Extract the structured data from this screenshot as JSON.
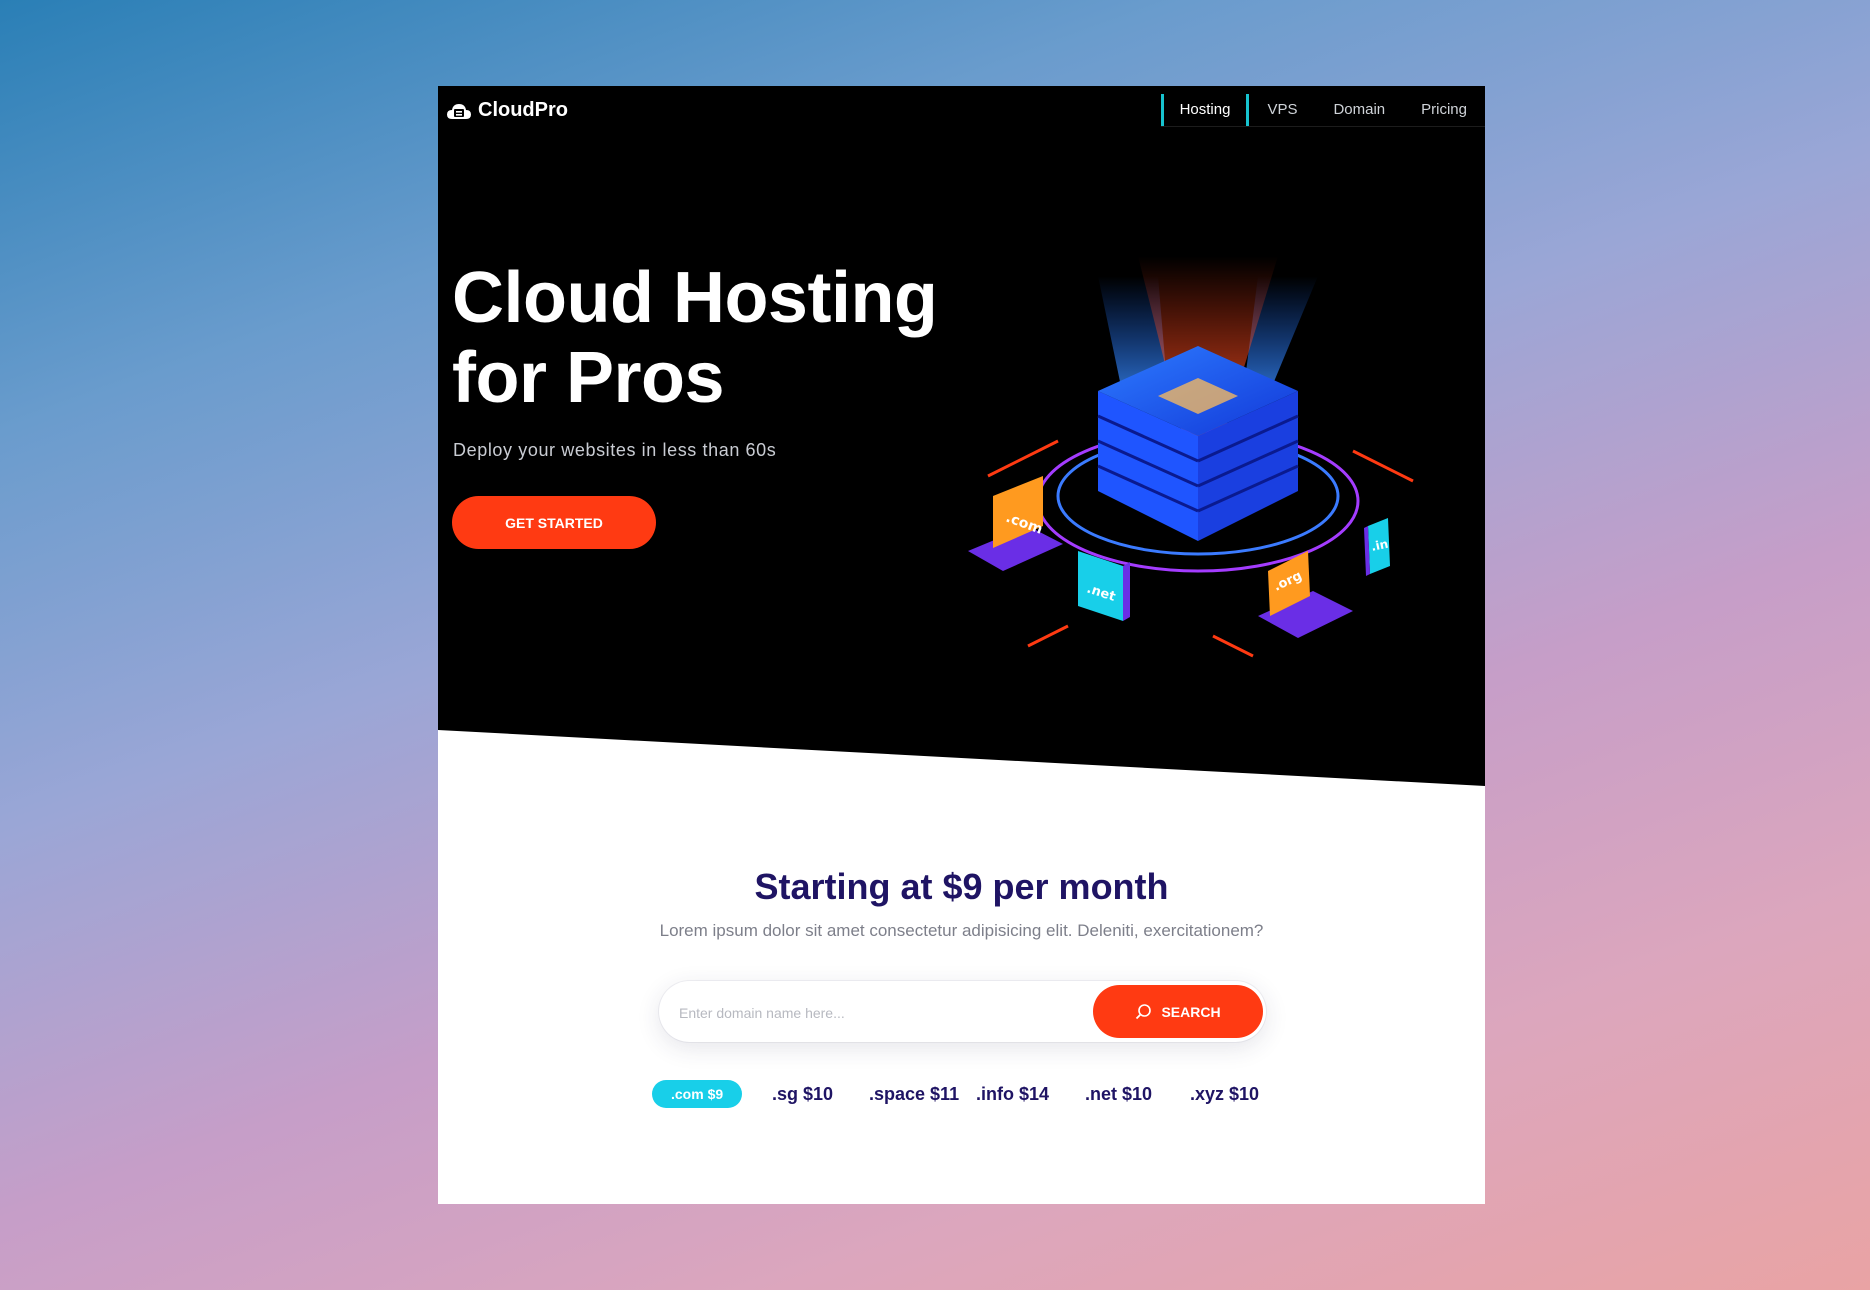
{
  "brand": {
    "name": "CloudPro",
    "logo_icon": "cloud-icon"
  },
  "nav": {
    "items": [
      {
        "label": "Hosting",
        "active": true
      },
      {
        "label": "VPS"
      },
      {
        "label": "Domain"
      },
      {
        "label": "Pricing"
      }
    ]
  },
  "hero": {
    "title_line1": "Cloud Hosting",
    "title_line2": "for Pros",
    "subtitle": "Deploy your websites in less than 60s",
    "cta_label": "GET STARTED",
    "illustration_labels": [
      ".com",
      ".net",
      ".org",
      ".in"
    ]
  },
  "pricing": {
    "headline": "Starting at $9 per month",
    "lead": "Lorem ipsum dolor sit amet consectetur adipisicing elit. Deleniti, exercitationem?"
  },
  "search": {
    "placeholder": "Enter domain name here...",
    "button_label": "SEARCH",
    "icon": "search-icon"
  },
  "tlds": [
    {
      "label": ".com $9",
      "active": true
    },
    {
      "label": ".sg $10"
    },
    {
      "label": ".space $11"
    },
    {
      "label": ".info $14"
    },
    {
      "label": ".net $10"
    },
    {
      "label": ".xyz $10"
    }
  ],
  "colors": {
    "accent": "#ff3a12",
    "teal": "#17c3cf",
    "navy": "#1f1464",
    "tld_active": "#18cfe9"
  }
}
